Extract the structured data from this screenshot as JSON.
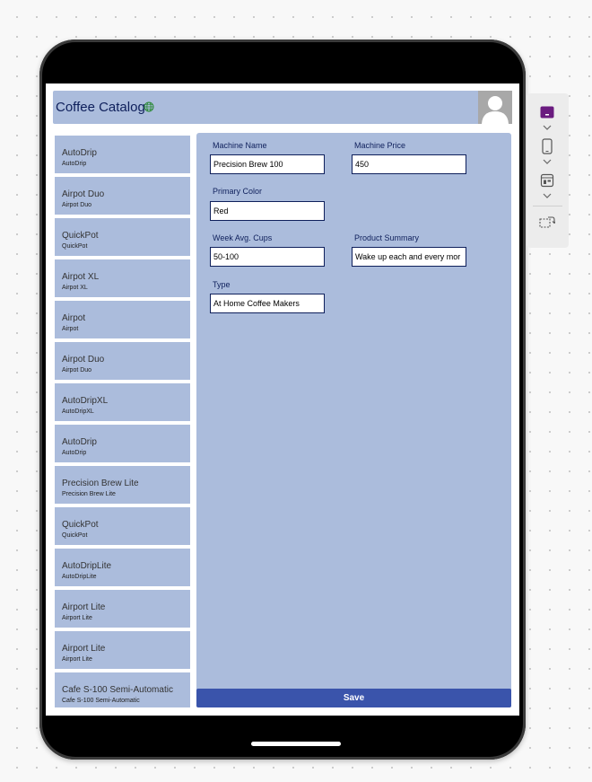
{
  "app": {
    "title": "Coffee Catalog",
    "colors": {
      "header_bg": "#abbcdc",
      "title_text": "#0e1f5b",
      "save_bg": "#3a54ab",
      "globe": "#2e8b3a",
      "toolbar_accent": "#6a1b7f"
    }
  },
  "header": {
    "title": "Coffee Catalog",
    "status_icon": "globe-icon",
    "avatar_icon": "user-avatar-icon"
  },
  "gallery": {
    "items": [
      {
        "title": "AutoDrip",
        "subtitle": "AutoDrip"
      },
      {
        "title": "Airpot Duo",
        "subtitle": "Airpot Duo"
      },
      {
        "title": "QuickPot",
        "subtitle": "QuickPot"
      },
      {
        "title": "Airpot XL",
        "subtitle": "Airpot XL"
      },
      {
        "title": "Airpot",
        "subtitle": "Airpot"
      },
      {
        "title": "Airpot Duo",
        "subtitle": "Airpot Duo"
      },
      {
        "title": "AutoDripXL",
        "subtitle": "AutoDripXL"
      },
      {
        "title": "AutoDrip",
        "subtitle": "AutoDrip"
      },
      {
        "title": "Precision Brew Lite",
        "subtitle": "Precision Brew Lite"
      },
      {
        "title": "QuickPot",
        "subtitle": "QuickPot"
      },
      {
        "title": "AutoDripLite",
        "subtitle": "AutoDripLite"
      },
      {
        "title": "Airport Lite",
        "subtitle": "Airport Lite"
      },
      {
        "title": "Airport Lite",
        "subtitle": "Airport Lite"
      },
      {
        "title": "Cafe S-100 Semi-Automatic",
        "subtitle": "Cafe S-100 Semi-Automatic"
      }
    ]
  },
  "form": {
    "machine_name": {
      "label": "Machine Name",
      "value": "Precision Brew 100"
    },
    "machine_price": {
      "label": "Machine Price",
      "value": "450"
    },
    "primary_color": {
      "label": "Primary Color",
      "value": "Red"
    },
    "week_avg_cups": {
      "label": "Week Avg. Cups",
      "value": "50-100"
    },
    "product_summary": {
      "label": "Product Summary",
      "value": "Wake up each and every mor"
    },
    "type": {
      "label": "Type",
      "value": "At Home Coffee Makers"
    },
    "save_label": "Save"
  },
  "side_toolbar": {
    "tools": [
      "color-theme-icon",
      "device-phone-icon",
      "layout-icon",
      "adjust-screen-icon"
    ]
  }
}
